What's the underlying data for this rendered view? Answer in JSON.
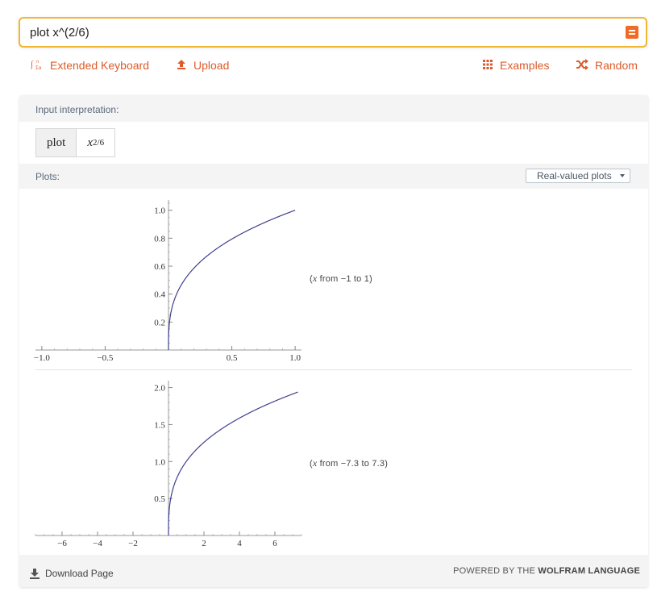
{
  "search": {
    "value": "plot x^(2/6)"
  },
  "toolbar": {
    "extended_keyboard": "Extended Keyboard",
    "upload": "Upload",
    "examples": "Examples",
    "random": "Random"
  },
  "pods": {
    "input_interpretation": {
      "title": "Input interpretation:",
      "keyword": "plot",
      "base": "x",
      "exponent": "2/6"
    },
    "plots": {
      "title": "Plots:",
      "dropdown": "Real-valued plots",
      "plot1_range": {
        "var": "x",
        "rest": "from −1 to 1)"
      },
      "plot2_range": {
        "var": "x",
        "rest": "from −7.3 to 7.3)"
      }
    }
  },
  "footer": {
    "download": "Download Page",
    "powered_prefix": "POWERED BY THE ",
    "powered_brand": "WOLFRAM LANGUAGE"
  },
  "colors": {
    "accent": "#dd5b2a",
    "curve": "#3f3f8f",
    "search_border": "#f2b631"
  },
  "chart_data": [
    {
      "type": "line",
      "function": "x^(2/6)",
      "x_ticks": [
        "−1.0",
        "−0.5",
        "0.5",
        "1.0"
      ],
      "y_ticks": [
        "0.2",
        "0.4",
        "0.6",
        "0.8",
        "1.0"
      ],
      "xlim": [
        -1.05,
        1.05
      ],
      "ylim": [
        0,
        1.05
      ],
      "x_domain": [
        0,
        1.0
      ]
    },
    {
      "type": "line",
      "function": "x^(2/6)",
      "x_ticks": [
        "−6",
        "−4",
        "−2",
        "2",
        "4",
        "6"
      ],
      "y_ticks": [
        "0.5",
        "1.0",
        "1.5",
        "2.0"
      ],
      "xlim": [
        -7.5,
        7.5
      ],
      "ylim": [
        0,
        2.05
      ],
      "x_domain": [
        0,
        7.3
      ]
    }
  ]
}
